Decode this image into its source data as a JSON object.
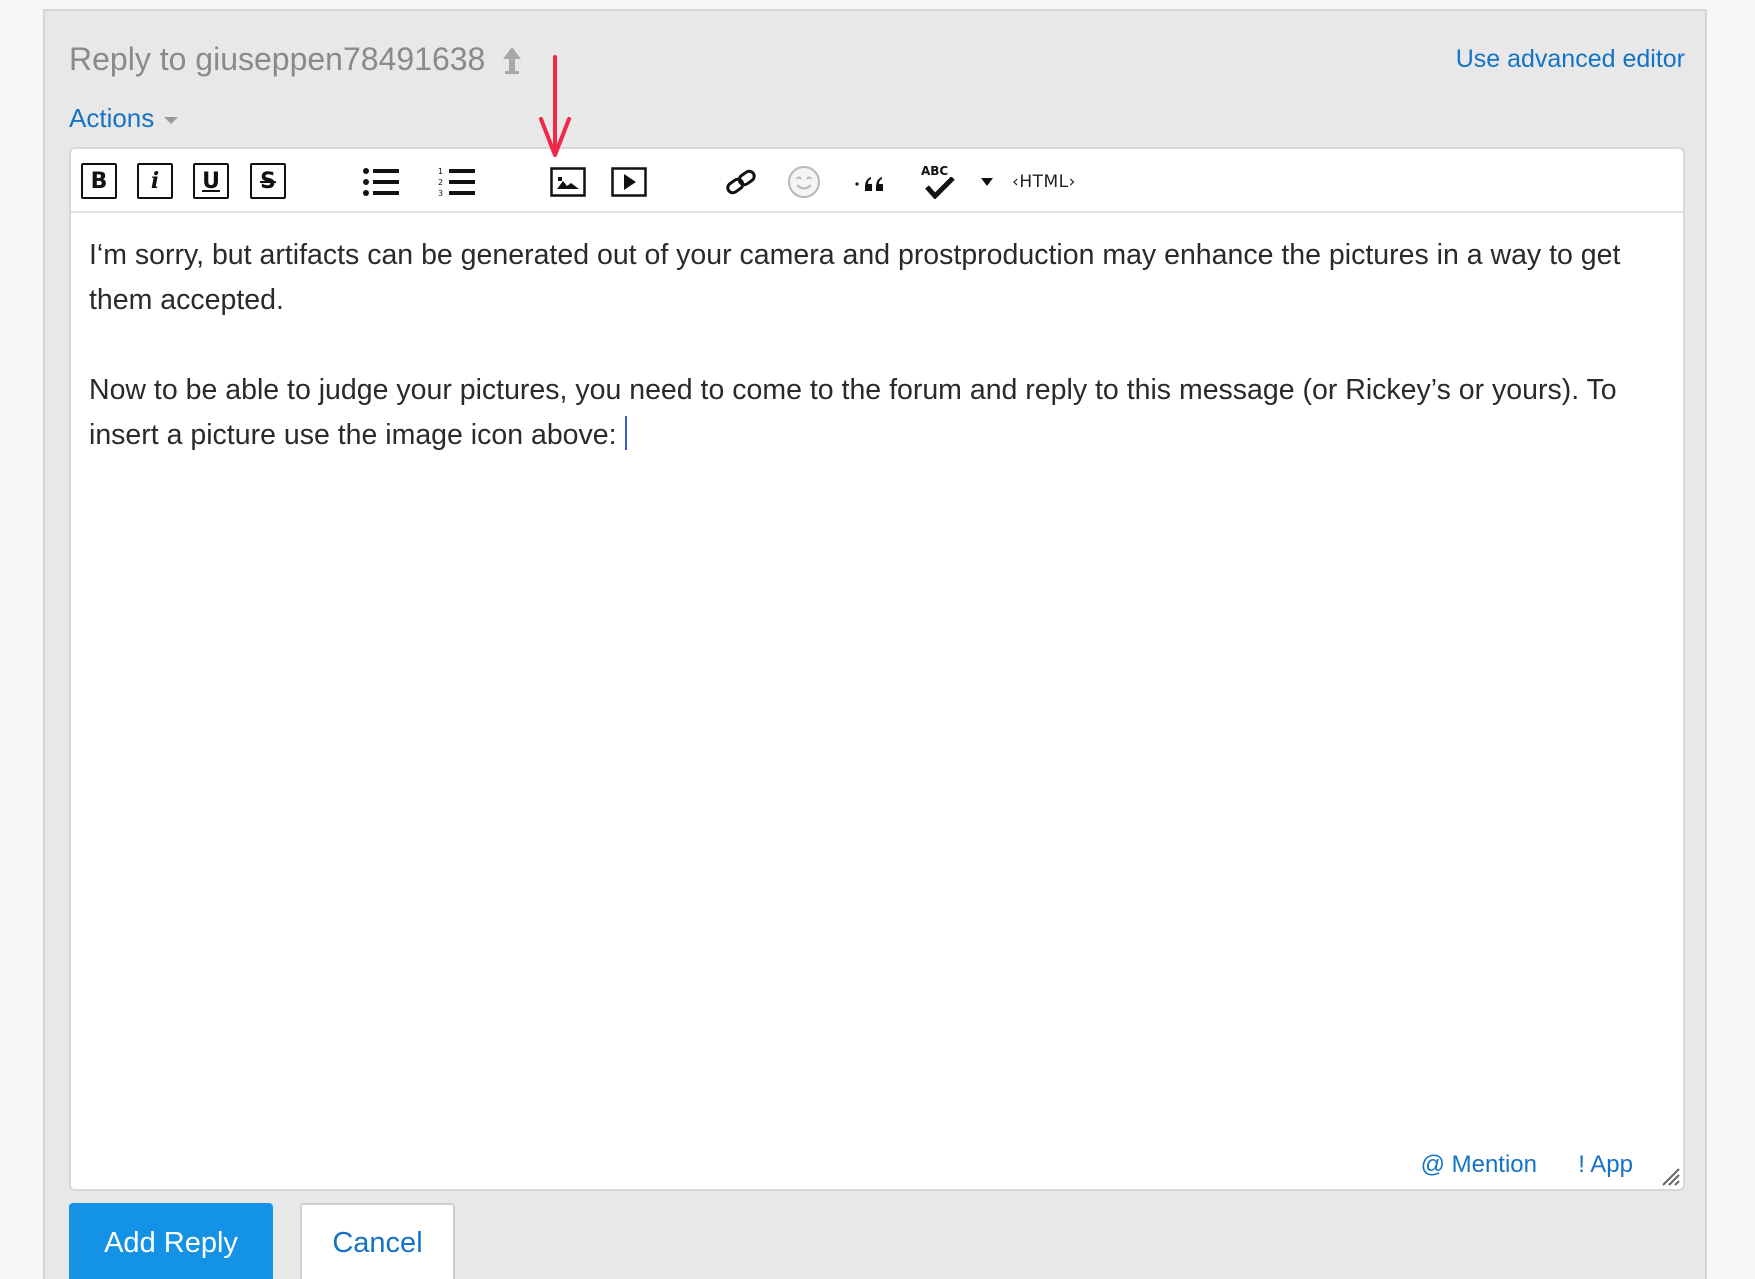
{
  "header": {
    "reply_title": "Reply to giuseppen78491638",
    "advanced_editor_label": "Use advanced editor",
    "actions_label": "Actions"
  },
  "toolbar": {
    "bold": "B",
    "italic": "i",
    "underline": "U",
    "strikethrough": "S",
    "spellcheck_label": "ABC",
    "html_label": "‹HTML›"
  },
  "editor": {
    "paragraphs": [
      "I‘m sorry, but artifacts can be generated out of your camera and prostproduction may enhance the pictures in a way to get them accepted.",
      "Now to be able to judge your pictures, you need to come to the forum and reply to this message (or Rickey’s or yours). To insert a picture use the image icon above:"
    ],
    "mention_label": "@ Mention",
    "app_label": "! App"
  },
  "buttons": {
    "add_reply": "Add Reply",
    "cancel": "Cancel"
  },
  "colors": {
    "link": "#1473c6",
    "primary_button": "#1493e6",
    "annotation_arrow": "#f0264a",
    "cursor": "#3a5ad9"
  }
}
